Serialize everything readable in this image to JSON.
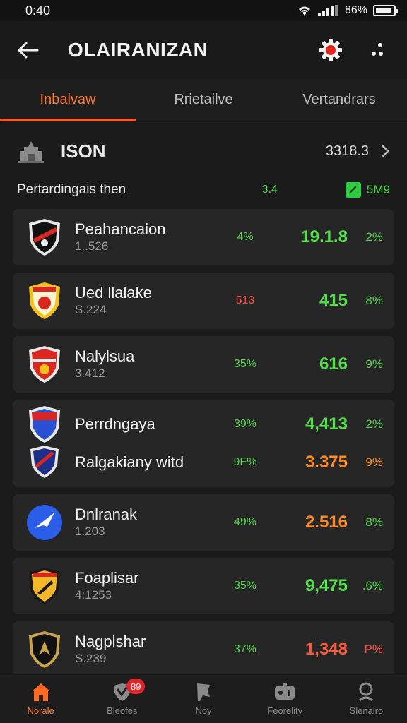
{
  "status_bar": {
    "time": "0:40",
    "battery": "86%",
    "battery_level": 0.86
  },
  "app_bar": {
    "title": "OLAIRANIZAN"
  },
  "tabs": [
    {
      "label": "Inbalvaw",
      "active": true
    },
    {
      "label": "Rrietailve",
      "active": false
    },
    {
      "label": "Vertandrars",
      "active": false
    }
  ],
  "section": {
    "title": "ISON",
    "value": "3318.3"
  },
  "summary": {
    "label": "Pertardingais then",
    "pct": "3.4",
    "change": "5M9"
  },
  "rows": [
    {
      "name": "Peahancaion",
      "sub": "1..526",
      "pct": "4%",
      "score": "19.1.8",
      "change": "2%",
      "score_color": "green",
      "pct_color": "green",
      "change_color": "green",
      "logo": "shield-red-black"
    },
    {
      "name": "Ued llalake",
      "sub": "S.224",
      "pct": "513",
      "score": "415",
      "change": "8%",
      "score_color": "green",
      "pct_color": "red",
      "change_color": "green",
      "logo": "shield-yellow-red"
    },
    {
      "name": "Nalylsua",
      "sub": "3.412",
      "pct": "35%",
      "score": "616",
      "change": "9%",
      "score_color": "green",
      "pct_color": "green",
      "change_color": "green",
      "logo": "shield-red-white"
    }
  ],
  "double_row": [
    {
      "name": "Perrdngaya",
      "pct": "39%",
      "score": "4,413",
      "change": "2%",
      "score_color": "green",
      "pct_color": "green",
      "change_color": "green",
      "logo": "shield-blue-red"
    },
    {
      "name": "Ralgakiany witd",
      "pct": "9F%",
      "score": "3.375",
      "change": "9%",
      "score_color": "orange",
      "pct_color": "green",
      "change_color": "orange",
      "logo": "shield-navy-red"
    }
  ],
  "rows_after": [
    {
      "name": "Dnlranak",
      "sub": "1.203",
      "pct": "49%",
      "score": "2.516",
      "change": "8%",
      "score_color": "orange",
      "pct_color": "green",
      "change_color": "green",
      "logo": "circle-blue-bird"
    },
    {
      "name": "Foaplisar",
      "sub": "4:1253",
      "pct": "35%",
      "score": "9,475",
      "change": ".6%",
      "score_color": "green",
      "pct_color": "green",
      "change_color": "green",
      "logo": "shield-yellow-black"
    },
    {
      "name": "Nagplshar",
      "sub": "S.239",
      "pct": "37%",
      "score": "1,348",
      "change": "P%",
      "score_color": "red",
      "pct_color": "green",
      "change_color": "red",
      "logo": "shield-black-gold"
    }
  ],
  "bottom_nav": [
    {
      "label": "Norale",
      "icon": "home-icon",
      "active": true
    },
    {
      "label": "Bleofes",
      "icon": "shield-check-icon",
      "badge": "89",
      "active": false
    },
    {
      "label": "Noy",
      "icon": "flag-icon",
      "active": false
    },
    {
      "label": "Feorelity",
      "icon": "gamepad-icon",
      "active": false
    },
    {
      "label": "Slenairo",
      "icon": "search-icon",
      "active": false
    }
  ],
  "colors": {
    "accent": "#ff5a1f",
    "positive": "#52e04a",
    "warning": "#ff8a24",
    "negative": "#ff4a3d",
    "background": "#1b1b1b",
    "card": "#262626"
  }
}
